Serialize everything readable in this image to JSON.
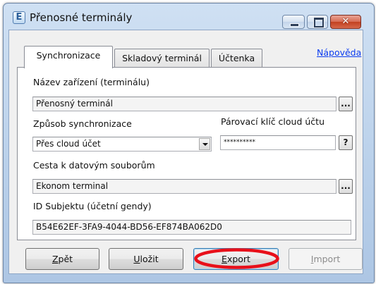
{
  "window": {
    "title": "Přenosné terminály",
    "app_icon_glyph": "E",
    "controls": {
      "close_glyph": "✕"
    }
  },
  "tabs": [
    {
      "label": "Synchronizace",
      "active": true
    },
    {
      "label": "Skladový terminál",
      "active": false
    },
    {
      "label": "Účtenka",
      "active": false
    }
  ],
  "help_link": "Nápověda",
  "form": {
    "device_name": {
      "label": "Název zařízení (terminálu)",
      "value": "Přenosný terminál",
      "button": "..."
    },
    "sync_method": {
      "label": "Způsob synchronizace",
      "value": "Přes cloud účet"
    },
    "pairing_key": {
      "label": "Párovací klíč cloud účtu",
      "value": "**********",
      "button": "?"
    },
    "data_path": {
      "label": "Cesta k datovým souborům",
      "value": "Ekonom terminal",
      "button": "..."
    },
    "subject_id": {
      "label": "ID Subjektu (účetní gendy)",
      "value": "B54E62EF-3FA9-4044-BD56-EF874BA062D0"
    }
  },
  "buttons": {
    "back": "Zpět",
    "save": "Uložit",
    "export": "Export",
    "import": "Import"
  },
  "annotation": {
    "color": "#e8101a"
  },
  "icons": [
    "app-icon",
    "minimize-icon",
    "maximize-icon",
    "close-icon",
    "dropdown-arrow-icon"
  ]
}
